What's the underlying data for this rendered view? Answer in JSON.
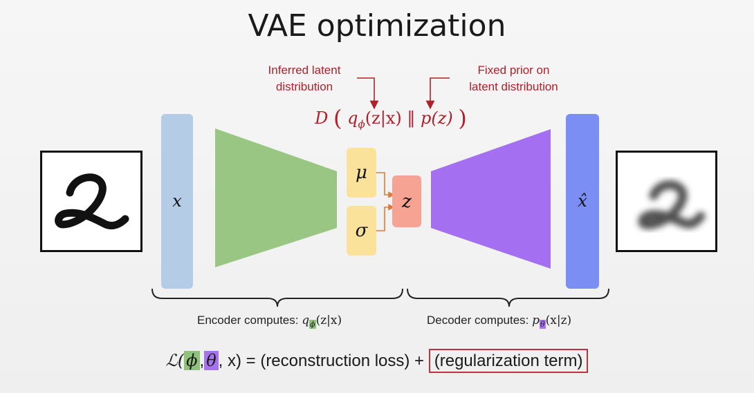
{
  "title": "VAE optimization",
  "annotations": {
    "inferred_latent": [
      "Inferred latent",
      "distribution"
    ],
    "fixed_prior": [
      "Fixed prior on",
      "latent distribution"
    ]
  },
  "kl_formula": {
    "divergence": "D",
    "q": "q",
    "phi": "ϕ",
    "q_args": "(z|x)",
    "separator": "‖",
    "prior": "p(z)"
  },
  "labels": {
    "input_var": "x",
    "output_var": "x̂",
    "mu": "μ",
    "sigma": "σ",
    "z": "z"
  },
  "captions": {
    "encoder_prefix": "Encoder computes:",
    "encoder_q": "q",
    "encoder_phi": "ϕ",
    "encoder_args": "(z|x)",
    "decoder_prefix": "Decoder computes:",
    "decoder_p": "p",
    "decoder_theta": "θ",
    "decoder_args": "(x|z)"
  },
  "loss": {
    "L": "ℒ(",
    "phi": "ϕ",
    "comma1": ",",
    "theta": "θ",
    "rest": ", x) = (reconstruction loss) +",
    "regularization": "(regularization term)"
  },
  "colors": {
    "encoder": "#99c683",
    "decoder": "#a46ff0",
    "latent_box": "#fbe29a",
    "z_box": "#f7a394",
    "input_bar": "#b4cce6",
    "output_bar": "#7b8ef4",
    "annotation": "#b0202a"
  }
}
